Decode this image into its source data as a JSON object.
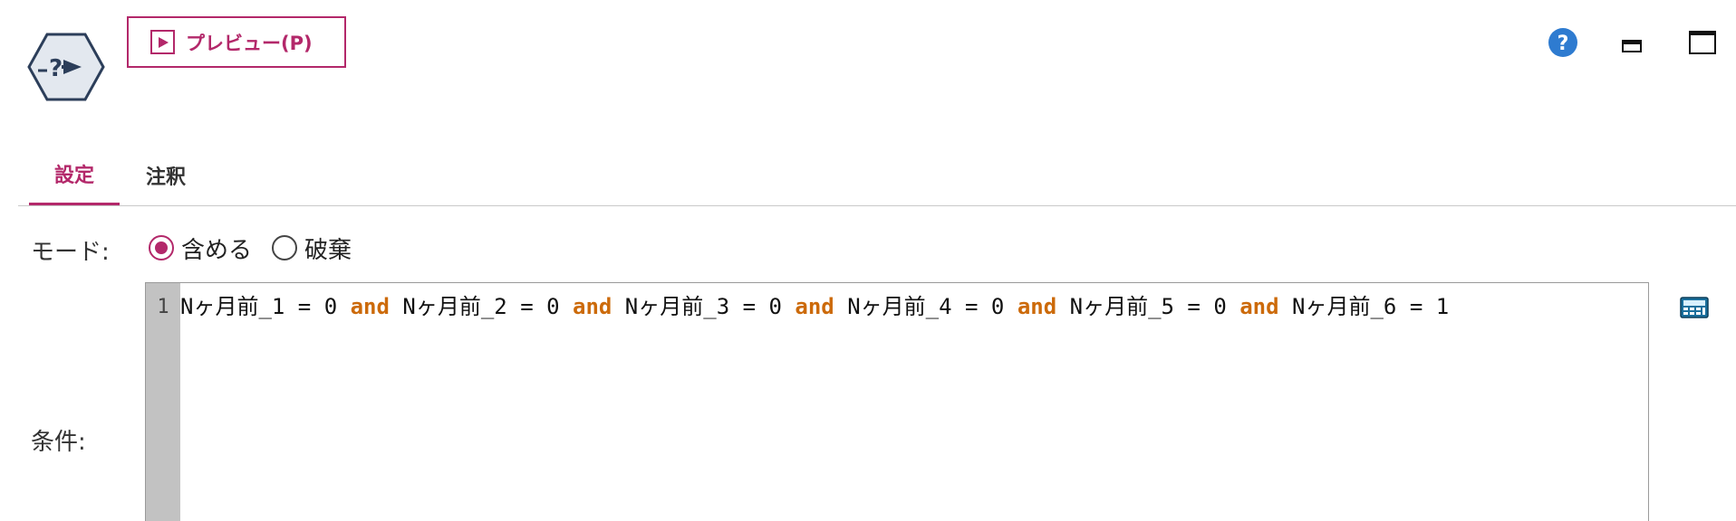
{
  "toolbar": {
    "preview_label": "プレビュー(P)"
  },
  "tabs": [
    {
      "label": "設定",
      "active": true
    },
    {
      "label": "注釈",
      "active": false
    }
  ],
  "mode": {
    "label": "モード:",
    "options": [
      {
        "label": "含める",
        "selected": true
      },
      {
        "label": "破棄",
        "selected": false
      }
    ]
  },
  "condition": {
    "label": "条件:",
    "line_number": "1",
    "tokens": [
      {
        "text": "Nヶ月前_1 = 0 ",
        "kw": false
      },
      {
        "text": "and",
        "kw": true
      },
      {
        "text": " Nヶ月前_2 = 0 ",
        "kw": false
      },
      {
        "text": "and",
        "kw": true
      },
      {
        "text": " Nヶ月前_3 = 0 ",
        "kw": false
      },
      {
        "text": "and",
        "kw": true
      },
      {
        "text": " Nヶ月前_4 = 0 ",
        "kw": false
      },
      {
        "text": "and",
        "kw": true
      },
      {
        "text": " Nヶ月前_5 = 0 ",
        "kw": false
      },
      {
        "text": "and",
        "kw": true
      },
      {
        "text": " Nヶ月前_6 = 1",
        "kw": false
      }
    ]
  },
  "colors": {
    "accent": "#b3286a",
    "keyword": "#cc6a0a",
    "help": "#2e7bd0",
    "node_fill": "#e3e8ef",
    "node_stroke": "#2c3e5a"
  },
  "icons": {
    "node": "select-node-icon",
    "preview": "play-icon",
    "help": "help-icon",
    "minimize": "minimize-icon",
    "maximize": "maximize-icon",
    "expression_builder": "calculator-icon"
  }
}
